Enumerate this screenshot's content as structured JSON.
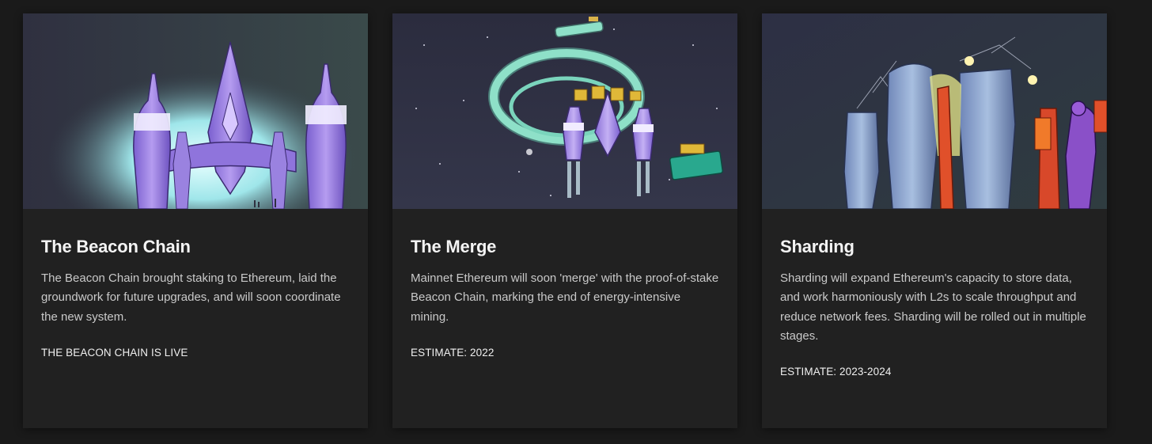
{
  "cards": [
    {
      "title": "The Beacon Chain",
      "description": "The Beacon Chain brought staking to Ethereum, laid the groundwork for future upgrades, and will soon coordinate the new system.",
      "status": "THE BEACON CHAIN IS LIVE",
      "image_icon": "rocket-ship-illustration"
    },
    {
      "title": "The Merge",
      "description": "Mainnet Ethereum will soon 'merge' with the proof-of-stake Beacon Chain, marking the end of energy-intensive mining.",
      "status": "ESTIMATE: 2022",
      "image_icon": "space-station-merge-illustration"
    },
    {
      "title": "Sharding",
      "description": "Sharding will expand Ethereum's capacity to store data, and work harmoniously with L2s to scale throughput and reduce network fees. Sharding will be rolled out in multiple stages.",
      "status": "ESTIMATE: 2023-2024",
      "image_icon": "sharding-construction-illustration"
    }
  ],
  "colors": {
    "page_background": "#1a1a1a",
    "card_background": "#212121",
    "title": "#f4f4f4",
    "description": "#c9c9c9",
    "status": "#f0f0f0"
  }
}
